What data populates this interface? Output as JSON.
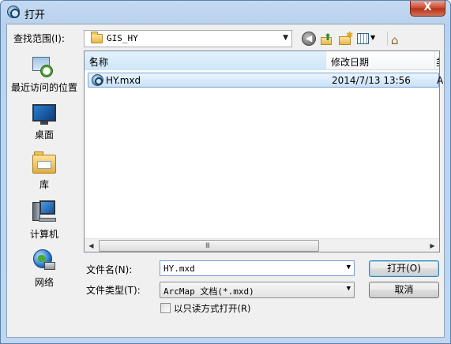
{
  "window": {
    "title": "打开",
    "close_glyph": "X"
  },
  "toolbar": {
    "look_in_label": "查找范围(I):",
    "look_in_value": "GIS_HY",
    "back_glyph": "◀",
    "home_glyph": "⌂"
  },
  "places": [
    {
      "label": "最近访问的位置",
      "icon": "recent-places-icon"
    },
    {
      "label": "桌面",
      "icon": "desktop-icon"
    },
    {
      "label": "库",
      "icon": "libraries-icon"
    },
    {
      "label": "计算机",
      "icon": "computer-icon"
    },
    {
      "label": "网络",
      "icon": "network-icon"
    }
  ],
  "file_list": {
    "columns": [
      "名称",
      "修改日期",
      "类"
    ],
    "rows": [
      {
        "name": "HY.mxd",
        "modified": "2014/7/13 13:56",
        "type": "A",
        "selected": true,
        "icon": "arcmap-document-icon"
      }
    ],
    "scroll_grip": "III"
  },
  "form": {
    "file_name_label": "文件名(N):",
    "file_name_value": "HY.mxd",
    "file_type_label": "文件类型(T):",
    "file_type_value": "ArcMap 文档(*.mxd)",
    "read_only_label": "以只读方式打开(R)",
    "read_only_checked": false
  },
  "buttons": {
    "open": "打开(O)",
    "cancel": "取消"
  },
  "colors": {
    "title_bar": "#c4daf2",
    "close_button": "#c8462d",
    "selection": "#c8e2f8",
    "default_button_border": "#3c7fb1"
  }
}
